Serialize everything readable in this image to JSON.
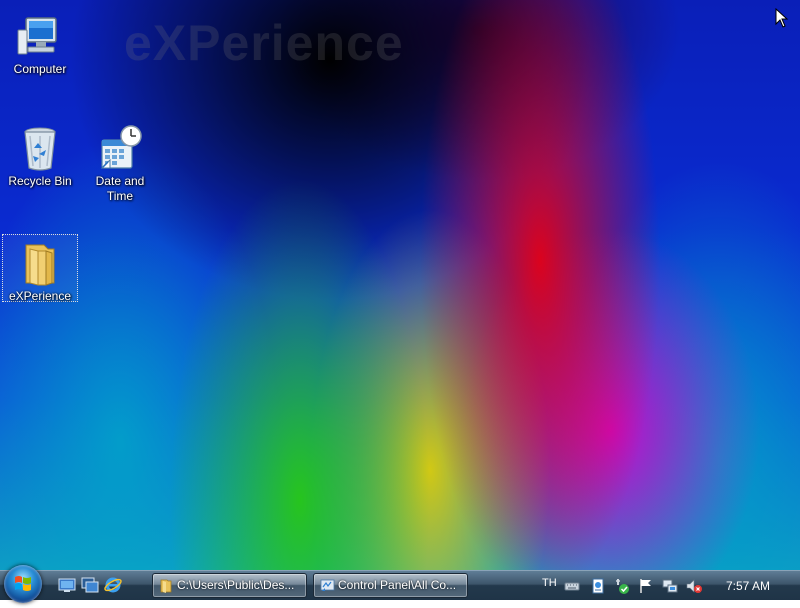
{
  "desktop": {
    "watermark": "eXPerience",
    "icons": [
      {
        "label": "Computer",
        "icon": "computer-icon"
      },
      {
        "label": "Recycle Bin",
        "icon": "recycle-bin-icon"
      },
      {
        "label": "Date and Time",
        "icon": "date-time-icon"
      },
      {
        "label": "eXPerience",
        "icon": "folder-icon"
      }
    ]
  },
  "taskbar": {
    "start_icon": "windows-logo-icon",
    "quick_launch": [
      "show-desktop-icon",
      "switch-windows-icon",
      "internet-explorer-icon"
    ],
    "tasks": [
      {
        "label": "C:\\Users\\Public\\Des...",
        "icon": "folder-icon"
      },
      {
        "label": "Control Panel\\All Co...",
        "icon": "control-panel-icon"
      }
    ],
    "tray": {
      "language": "TH",
      "icons": [
        "keyboard-icon",
        "document-icon",
        "security-icon",
        "flag-icon",
        "network-icon",
        "volume-muted-icon"
      ],
      "clock": "7:57 AM"
    }
  },
  "colors": {
    "taskbar": "#2b4257",
    "desktop_base": "#0a2bd0"
  }
}
